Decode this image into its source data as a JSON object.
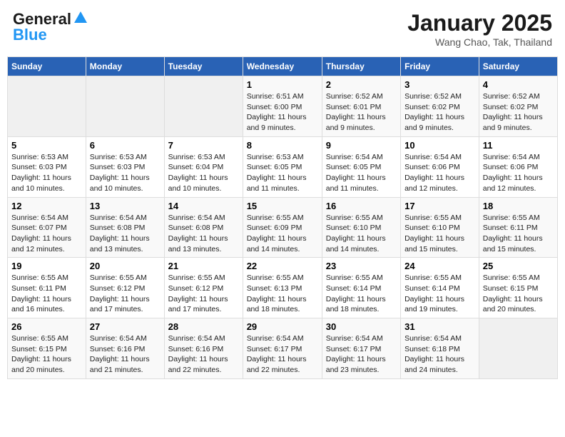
{
  "header": {
    "logo_line1": "General",
    "logo_line2": "Blue",
    "month": "January 2025",
    "location": "Wang Chao, Tak, Thailand"
  },
  "weekdays": [
    "Sunday",
    "Monday",
    "Tuesday",
    "Wednesday",
    "Thursday",
    "Friday",
    "Saturday"
  ],
  "weeks": [
    [
      {
        "day": "",
        "info": ""
      },
      {
        "day": "",
        "info": ""
      },
      {
        "day": "",
        "info": ""
      },
      {
        "day": "1",
        "info": "Sunrise: 6:51 AM\nSunset: 6:00 PM\nDaylight: 11 hours\nand 9 minutes."
      },
      {
        "day": "2",
        "info": "Sunrise: 6:52 AM\nSunset: 6:01 PM\nDaylight: 11 hours\nand 9 minutes."
      },
      {
        "day": "3",
        "info": "Sunrise: 6:52 AM\nSunset: 6:02 PM\nDaylight: 11 hours\nand 9 minutes."
      },
      {
        "day": "4",
        "info": "Sunrise: 6:52 AM\nSunset: 6:02 PM\nDaylight: 11 hours\nand 9 minutes."
      }
    ],
    [
      {
        "day": "5",
        "info": "Sunrise: 6:53 AM\nSunset: 6:03 PM\nDaylight: 11 hours\nand 10 minutes."
      },
      {
        "day": "6",
        "info": "Sunrise: 6:53 AM\nSunset: 6:03 PM\nDaylight: 11 hours\nand 10 minutes."
      },
      {
        "day": "7",
        "info": "Sunrise: 6:53 AM\nSunset: 6:04 PM\nDaylight: 11 hours\nand 10 minutes."
      },
      {
        "day": "8",
        "info": "Sunrise: 6:53 AM\nSunset: 6:05 PM\nDaylight: 11 hours\nand 11 minutes."
      },
      {
        "day": "9",
        "info": "Sunrise: 6:54 AM\nSunset: 6:05 PM\nDaylight: 11 hours\nand 11 minutes."
      },
      {
        "day": "10",
        "info": "Sunrise: 6:54 AM\nSunset: 6:06 PM\nDaylight: 11 hours\nand 12 minutes."
      },
      {
        "day": "11",
        "info": "Sunrise: 6:54 AM\nSunset: 6:06 PM\nDaylight: 11 hours\nand 12 minutes."
      }
    ],
    [
      {
        "day": "12",
        "info": "Sunrise: 6:54 AM\nSunset: 6:07 PM\nDaylight: 11 hours\nand 12 minutes."
      },
      {
        "day": "13",
        "info": "Sunrise: 6:54 AM\nSunset: 6:08 PM\nDaylight: 11 hours\nand 13 minutes."
      },
      {
        "day": "14",
        "info": "Sunrise: 6:54 AM\nSunset: 6:08 PM\nDaylight: 11 hours\nand 13 minutes."
      },
      {
        "day": "15",
        "info": "Sunrise: 6:55 AM\nSunset: 6:09 PM\nDaylight: 11 hours\nand 14 minutes."
      },
      {
        "day": "16",
        "info": "Sunrise: 6:55 AM\nSunset: 6:10 PM\nDaylight: 11 hours\nand 14 minutes."
      },
      {
        "day": "17",
        "info": "Sunrise: 6:55 AM\nSunset: 6:10 PM\nDaylight: 11 hours\nand 15 minutes."
      },
      {
        "day": "18",
        "info": "Sunrise: 6:55 AM\nSunset: 6:11 PM\nDaylight: 11 hours\nand 15 minutes."
      }
    ],
    [
      {
        "day": "19",
        "info": "Sunrise: 6:55 AM\nSunset: 6:11 PM\nDaylight: 11 hours\nand 16 minutes."
      },
      {
        "day": "20",
        "info": "Sunrise: 6:55 AM\nSunset: 6:12 PM\nDaylight: 11 hours\nand 17 minutes."
      },
      {
        "day": "21",
        "info": "Sunrise: 6:55 AM\nSunset: 6:12 PM\nDaylight: 11 hours\nand 17 minutes."
      },
      {
        "day": "22",
        "info": "Sunrise: 6:55 AM\nSunset: 6:13 PM\nDaylight: 11 hours\nand 18 minutes."
      },
      {
        "day": "23",
        "info": "Sunrise: 6:55 AM\nSunset: 6:14 PM\nDaylight: 11 hours\nand 18 minutes."
      },
      {
        "day": "24",
        "info": "Sunrise: 6:55 AM\nSunset: 6:14 PM\nDaylight: 11 hours\nand 19 minutes."
      },
      {
        "day": "25",
        "info": "Sunrise: 6:55 AM\nSunset: 6:15 PM\nDaylight: 11 hours\nand 20 minutes."
      }
    ],
    [
      {
        "day": "26",
        "info": "Sunrise: 6:55 AM\nSunset: 6:15 PM\nDaylight: 11 hours\nand 20 minutes."
      },
      {
        "day": "27",
        "info": "Sunrise: 6:54 AM\nSunset: 6:16 PM\nDaylight: 11 hours\nand 21 minutes."
      },
      {
        "day": "28",
        "info": "Sunrise: 6:54 AM\nSunset: 6:16 PM\nDaylight: 11 hours\nand 22 minutes."
      },
      {
        "day": "29",
        "info": "Sunrise: 6:54 AM\nSunset: 6:17 PM\nDaylight: 11 hours\nand 22 minutes."
      },
      {
        "day": "30",
        "info": "Sunrise: 6:54 AM\nSunset: 6:17 PM\nDaylight: 11 hours\nand 23 minutes."
      },
      {
        "day": "31",
        "info": "Sunrise: 6:54 AM\nSunset: 6:18 PM\nDaylight: 11 hours\nand 24 minutes."
      },
      {
        "day": "",
        "info": ""
      }
    ]
  ]
}
